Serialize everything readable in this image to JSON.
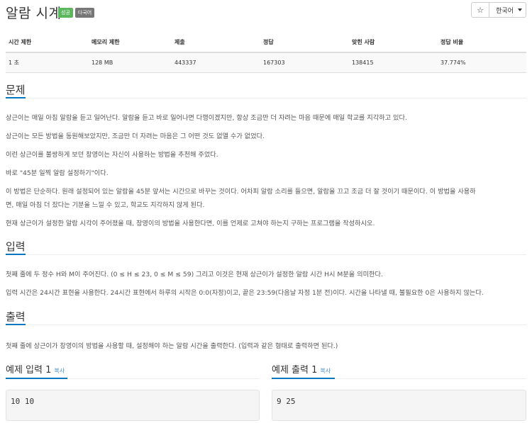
{
  "problem": {
    "title": "알람 시계",
    "badges": [
      "성공",
      "다국어"
    ],
    "star": "☆",
    "language": "한국어"
  },
  "info": {
    "headers": [
      "시간 제한",
      "메모리 제한",
      "제출",
      "정답",
      "맞힌 사람",
      "정답 비율"
    ],
    "values": [
      "1 초",
      "128 MB",
      "443337",
      "167303",
      "138415",
      "37.774%"
    ]
  },
  "sections": {
    "description": {
      "title": "문제",
      "lines": [
        "상근이는 매일 아침 알람을 듣고 일어난다. 알람을 듣고 바로 일어나면 다행이겠지만, 항상 조금만 더 자려는 마음 때문에 매일 학교를 지각하고 있다.",
        "상근이는 모든 방법을 동원해보았지만, 조금만 더 자려는 마음은 그 어떤 것도 없앨 수가 없었다.",
        "이런 상근이를 불쌍하게 보던 창영이는 자신이 사용하는 방법을 추천해 주었다.",
        "바로 \"45분 일찍 알람 설정하기\"이다.",
        "이 방법은 단순하다. 원래 설정되어 있는 알람을 45분 앞서는 시간으로 바꾸는 것이다. 어차피 알람 소리를 들으면, 알람을 끄고 조금 더 잘 것이기 때문이다. 이 방법을 사용하",
        "면, 매일 아침 더 잤다는 기분을 느낄 수 있고, 학교도 지각하지 않게 된다.",
        "현재 상근이가 설정한 알람 시각이 주어졌을 때, 창영이의 방법을 사용한다면, 이를 언제로 고쳐야 하는지 구하는 프로그램을 작성하시오."
      ]
    },
    "input": {
      "title": "입력",
      "lines": [
        "첫째 줄에 두 정수 H와 M이 주어진다. (0 ≤ H ≤ 23, 0 ≤ M ≤ 59) 그리고 이것은 현재 상근이가 설정한 알람 시간 H시 M분을 의미한다.",
        "입력 시간은 24시간 표현을 사용한다. 24시간 표현에서 하루의 시작은 0:0(자정)이고, 끝은 23:59(다음날 자정 1분 전)이다. 시간을 나타낼 때, 불필요한 0은 사용하지 않는다."
      ]
    },
    "output": {
      "title": "출력",
      "lines": [
        "첫째 줄에 상근이가 창영이의 방법을 사용할 때, 설정해야 하는 알람 시간을 출력한다. (입력과 같은 형태로 출력하면 된다.)"
      ]
    }
  },
  "samples": {
    "input": {
      "title": "예제 입력 1",
      "copy": "복사",
      "content": "10 10"
    },
    "output": {
      "title": "예제 출력 1",
      "copy": "복사",
      "content": "9 25"
    }
  },
  "colors": {
    "accent": "#0076c0",
    "success": "#5cb85c",
    "badge_gray": "#777777",
    "link": "#428bca"
  }
}
